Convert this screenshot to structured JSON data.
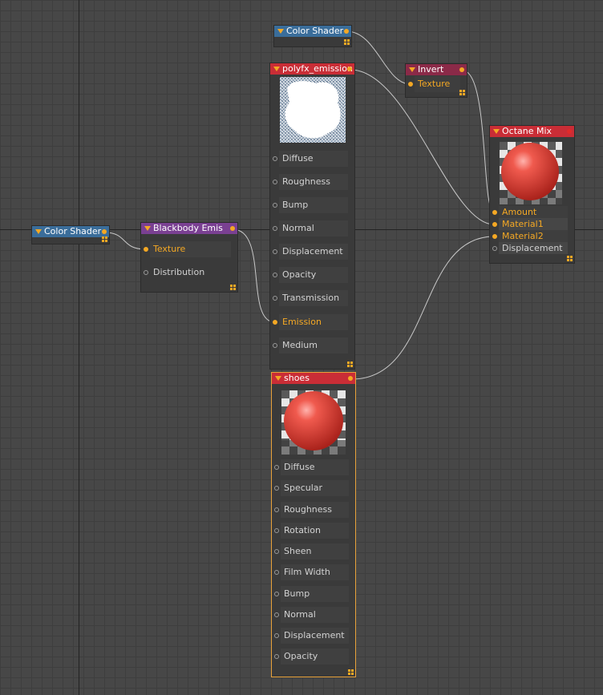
{
  "nodes": {
    "color_shader_top": {
      "title": "Color Shader"
    },
    "polyfx_emission": {
      "title": "polyfx_emission",
      "ports": [
        "Diffuse",
        "Roughness",
        "Bump",
        "Normal",
        "Displacement",
        "Opacity",
        "Transmission",
        "Emission",
        "Medium"
      ]
    },
    "invert": {
      "title": "Invert",
      "ports": [
        "Texture"
      ]
    },
    "octane_mix": {
      "title": "Octane Mix",
      "ports": [
        "Amount",
        "Material1",
        "Material2",
        "Displacement"
      ]
    },
    "color_shader_left": {
      "title": "Color Shader"
    },
    "blackbody_emis": {
      "title": "Blackbody Emis",
      "ports": [
        "Texture",
        "Distribution"
      ]
    },
    "shoes": {
      "title": "shoes",
      "ports": [
        "Diffuse",
        "Specular",
        "Roughness",
        "Rotation",
        "Sheen",
        "Film Width",
        "Bump",
        "Normal",
        "Displacement",
        "Opacity"
      ]
    }
  },
  "colors": {
    "accent": "#f4a824",
    "header_blue": "#3a6d9a",
    "header_red": "#c92d36",
    "header_wine": "#8b2a48",
    "header_purple": "#7a4092",
    "wire": "#c8c8c8"
  }
}
